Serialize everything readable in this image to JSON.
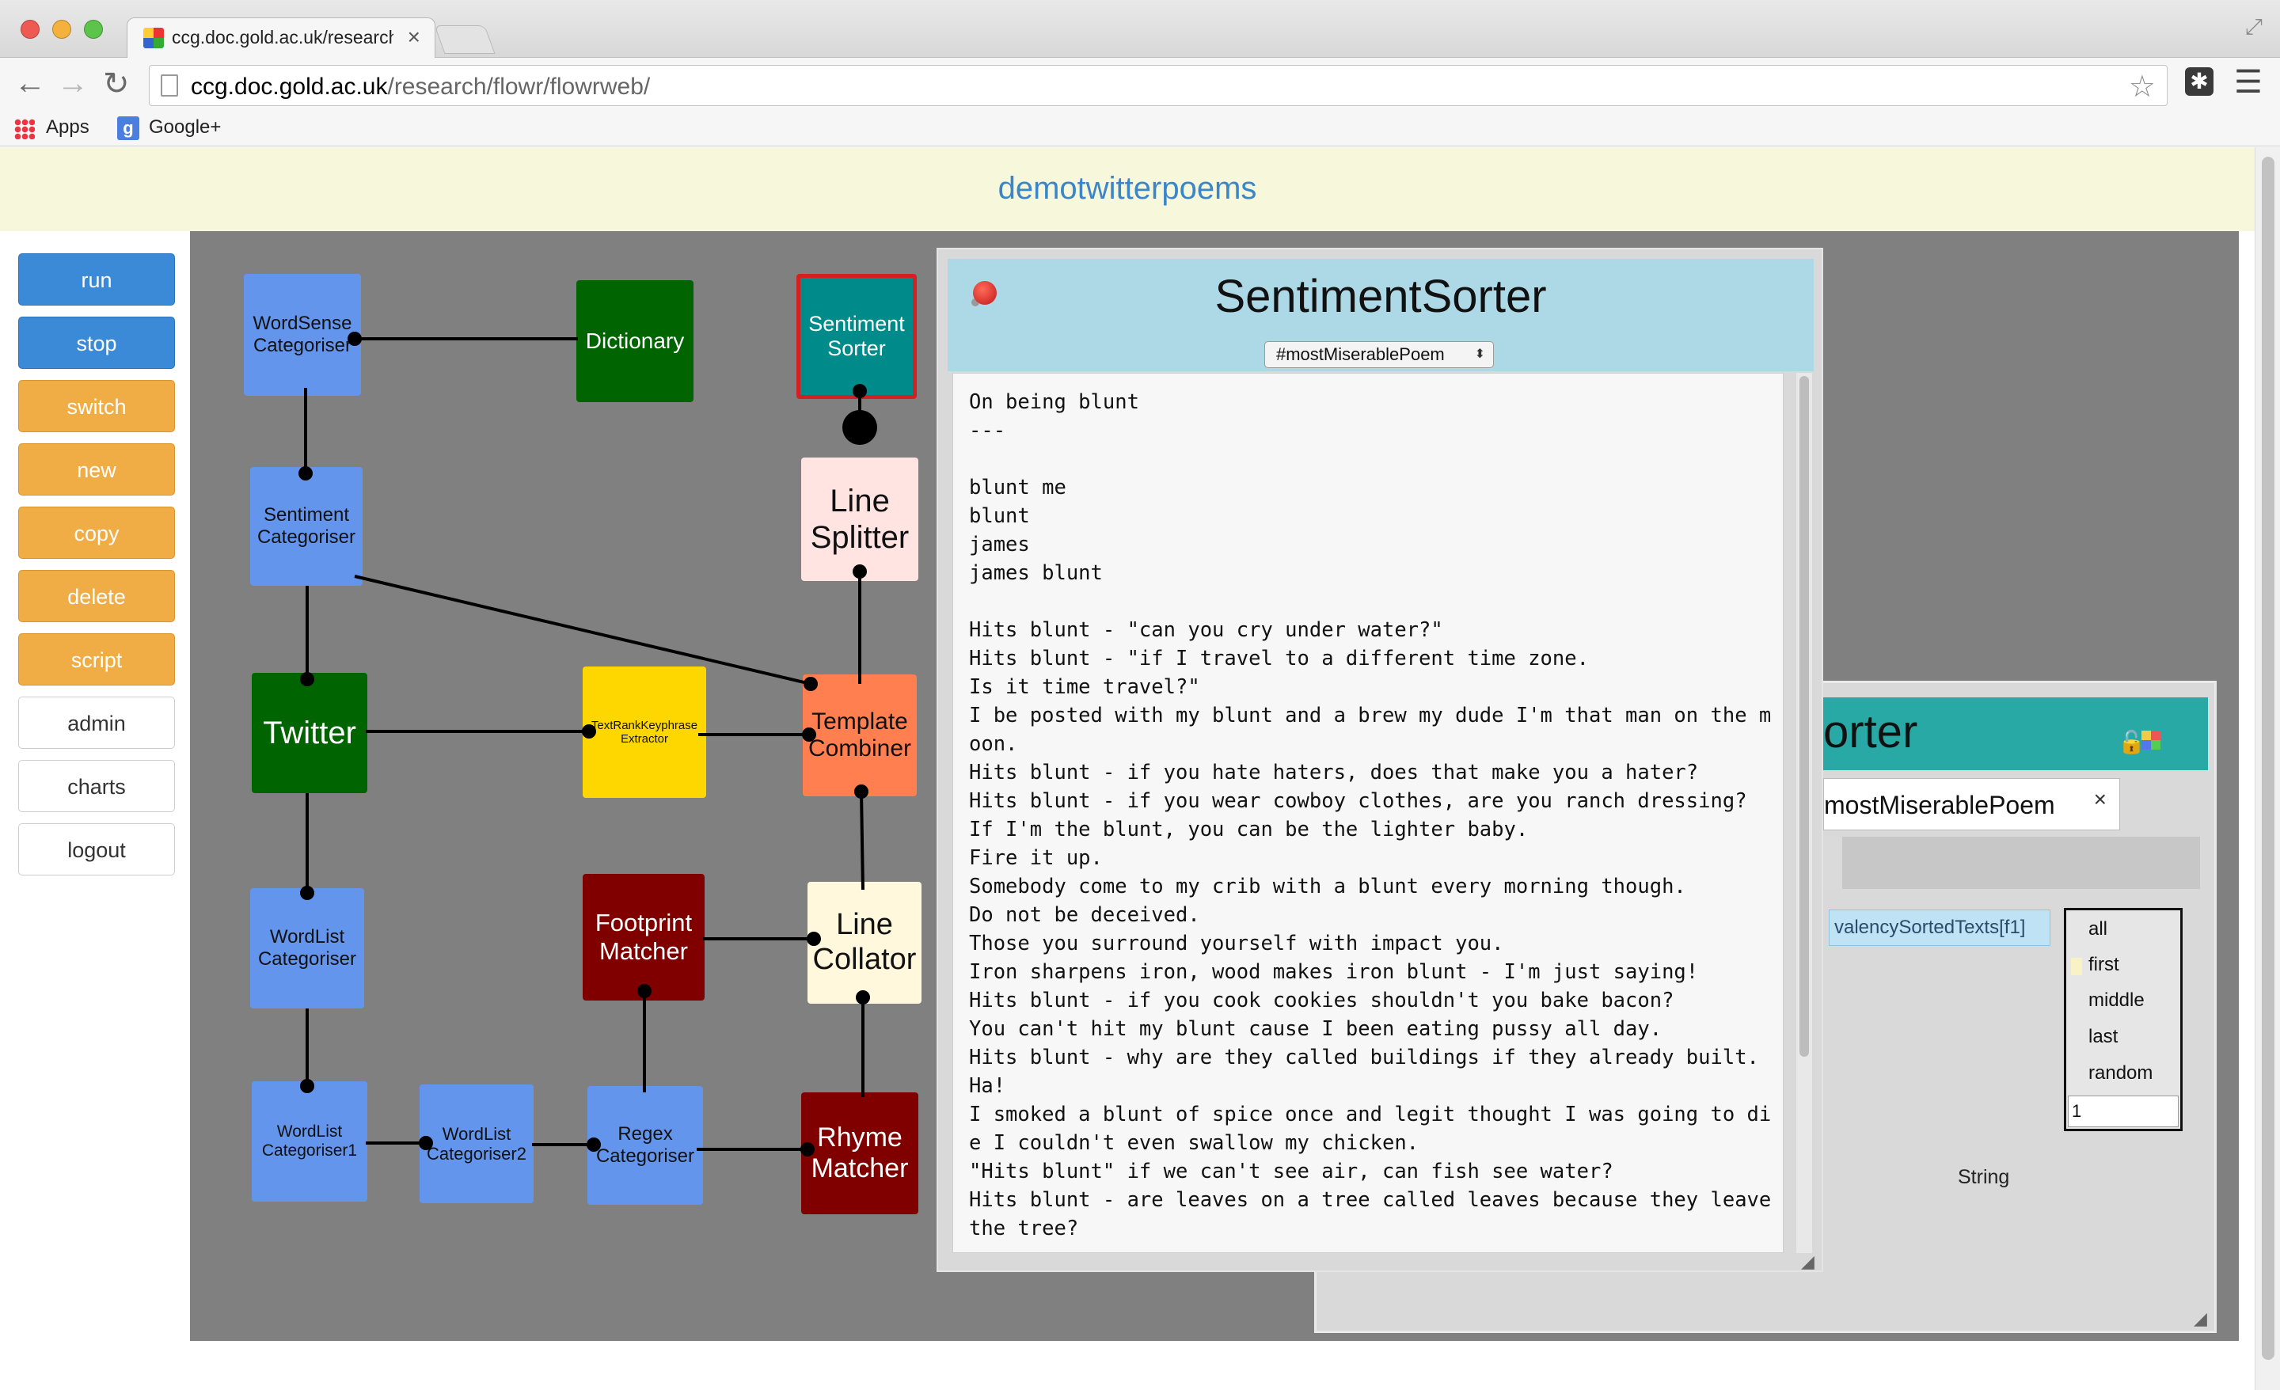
{
  "browser": {
    "tab_title": "ccg.doc.gold.ac.uk/research/flowr",
    "tab_close": "×",
    "url_host": "ccg.doc.gold.ac.uk",
    "url_path": "/research/flowr/flowrweb/",
    "bookmarks": [
      "Apps",
      "Google+"
    ],
    "traffic_colors": [
      "#ee5a52",
      "#f4b13b",
      "#5cc44a"
    ]
  },
  "app": {
    "title": "demotwitterpoems"
  },
  "menu": [
    {
      "label": "run",
      "style": "blue"
    },
    {
      "label": "stop",
      "style": "blue"
    },
    {
      "label": "switch",
      "style": "orange"
    },
    {
      "label": "new",
      "style": "orange"
    },
    {
      "label": "copy",
      "style": "orange"
    },
    {
      "label": "delete",
      "style": "orange"
    },
    {
      "label": "script",
      "style": "orange"
    },
    {
      "label": "admin",
      "style": "white"
    },
    {
      "label": "charts",
      "style": "white"
    },
    {
      "label": "logout",
      "style": "white"
    }
  ],
  "nodes": {
    "wordsense": "WordSense Categoriser",
    "dictionary": "Dictionary",
    "sentiment_sorter": "Sentiment Sorter",
    "sentiment_categoriser": "Sentiment Categoriser",
    "line_splitter": "Line Splitter",
    "twitter": "Twitter",
    "textrank": "TextRankKeyphrase Extractor",
    "template_combiner": "Template Combiner",
    "wordlist_categoriser": "WordList Categoriser",
    "footprint": "Footprint Matcher",
    "line_collator": "Line Collator",
    "wordlist1": "WordList Categoriser1",
    "wordlist2": "WordList Categoriser2",
    "regex": "Regex Categoriser",
    "rhyme": "Rhyme Matcher"
  },
  "node_colors": {
    "blue": "#6495ed",
    "green": "#006400",
    "teal": "#008b8b",
    "selected_border": "#d42020",
    "pink": "#ffe4e1",
    "yellow": "#ffd700",
    "coral": "#ff7f50",
    "maroon": "#800000",
    "cream": "#fff8dc"
  },
  "front_panel": {
    "title": "SentimentSorter",
    "dropdown_value": "#mostMiserablePoem",
    "output_text": "On being blunt\n---\n\nblunt me\nblunt\njames\njames blunt\n\nHits blunt - \"can you cry under water?\"\nHits blunt - \"if I travel to a different time zone.\nIs it time travel?\"\nI be posted with my blunt and a brew my dude I'm that man on the moon.\nHits blunt - if you hate haters, does that make you a hater?\nHits blunt - if you wear cowboy clothes, are you ranch dressing?\nIf I'm the blunt, you can be the lighter baby.\nFire it up.\nSomebody come to my crib with a blunt every morning though.\nDo not be deceived.\nThose you surround yourself with impact you.\nIron sharpens iron, wood makes iron blunt - I'm just saying!\nHits blunt - if you cook cookies shouldn't you bake bacon?\nYou can't hit my blunt cause I been eating pussy all day.\nHits blunt - why are they called buildings if they already built.\nHa!\nI smoked a blunt of spice once and legit thought I was going to die I couldn't even swallow my chicken.\n\"Hits blunt\" if we can't see air, can fish see water?\nHits blunt - are leaves on a tree called leaves because they leave the tree?"
  },
  "back_panel": {
    "title_fragment": "orter",
    "tab_label": "mostMiserablePoem",
    "tab_close": "×",
    "chip": "valencySortedTexts[f1]",
    "options": [
      "all",
      "first",
      "middle",
      "last",
      "random"
    ],
    "input_value": "1",
    "type_label": "String"
  }
}
